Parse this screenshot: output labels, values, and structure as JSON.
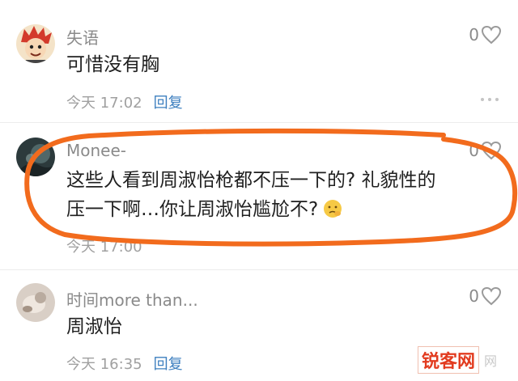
{
  "comments": [
    {
      "username": "失语",
      "text": "可惜没有胸",
      "time": "今天 17:02",
      "reply": "回复",
      "likes": "0"
    },
    {
      "username": "Monee-",
      "text_line1": "这些人看到周淑怡枪都不压一下的? 礼貌性的",
      "text_line2": "压一下啊…你让周淑怡尴尬不?",
      "time": "今天 17:00",
      "likes": "0"
    },
    {
      "username": "时间more than...",
      "text": "周淑怡",
      "time": "今天 16:35",
      "reply": "回复",
      "likes": "0"
    }
  ],
  "watermark": {
    "text": "锐客网",
    "sub": "网"
  },
  "colors": {
    "highlight_stroke": "#f26b1d",
    "reply_link": "#3d7fbf"
  }
}
